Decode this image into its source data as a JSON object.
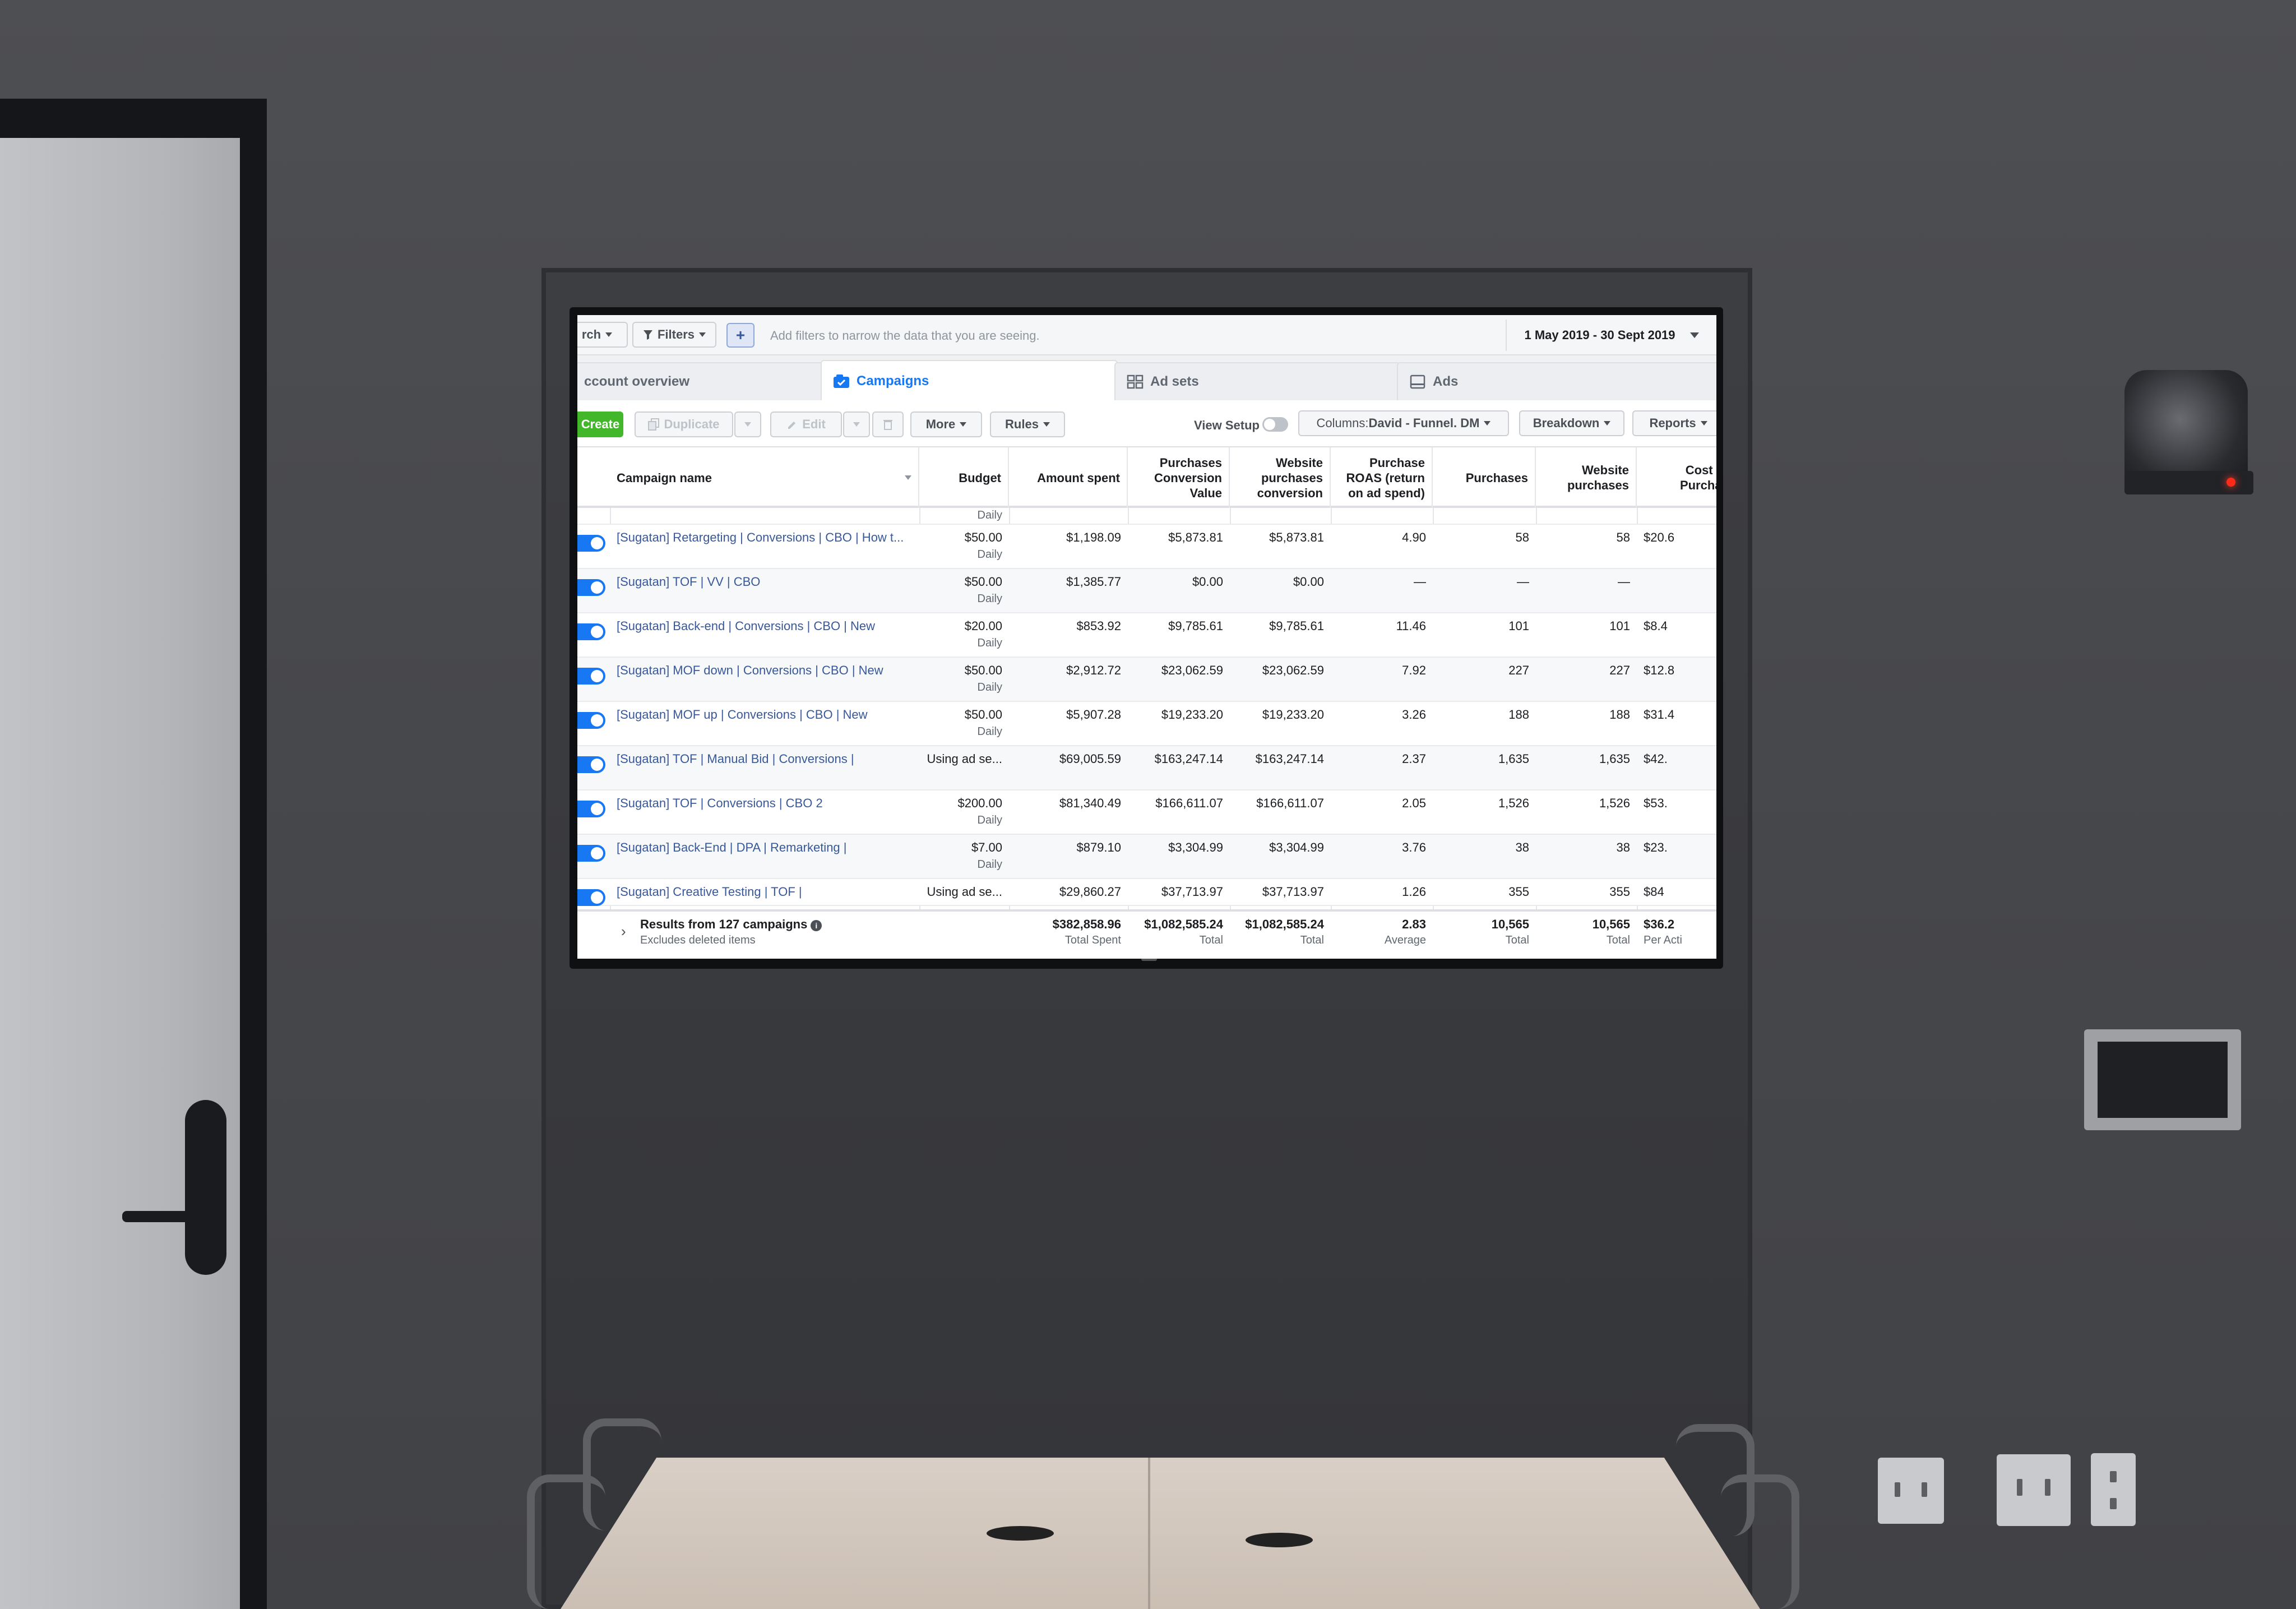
{
  "toolbar": {
    "search_label": "rch",
    "filters_label": "Filters",
    "add_symbol": "+",
    "filter_placeholder": "Add filters to narrow the data that you are seeing.",
    "date_range": "1 May 2019 - 30 Sept 2019"
  },
  "tabs": [
    {
      "label": "ccount overview"
    },
    {
      "label": "Campaigns"
    },
    {
      "label": "Ad sets"
    },
    {
      "label": "Ads"
    }
  ],
  "actions": {
    "create": "Create",
    "duplicate": "Duplicate",
    "edit": "Edit",
    "more": "More",
    "rules": "Rules",
    "view_setup": "View Setup",
    "columns_prefix": "Columns: ",
    "columns_value": "David - Funnel. DM",
    "breakdown": "Breakdown",
    "reports": "Reports"
  },
  "columns": [
    "Campaign name",
    "Budget",
    "Amount spent",
    "Purchases Conversion Value",
    "Website purchases conversion",
    "Purchase ROAS (return on ad spend)",
    "Purchases",
    "Website purchases",
    "Cost per Purchase"
  ],
  "partial_row_budget_sub": "Daily",
  "rows": [
    {
      "name": "[Sugatan] Retargeting | Conversions | CBO | How t...",
      "budget": "$50.00",
      "budget_sub": "Daily",
      "spent": "$1,198.09",
      "conv_value": "$5,873.81",
      "web_conv": "$5,873.81",
      "roas": "4.90",
      "purchases": "58",
      "web_purchases": "58",
      "cost": "$20.6"
    },
    {
      "name": "[Sugatan] TOF | VV | CBO",
      "budget": "$50.00",
      "budget_sub": "Daily",
      "spent": "$1,385.77",
      "conv_value": "$0.00",
      "web_conv": "$0.00",
      "roas": "—",
      "purchases": "—",
      "web_purchases": "—",
      "cost": ""
    },
    {
      "name": "[Sugatan] Back-end | Conversions | CBO | New",
      "budget": "$20.00",
      "budget_sub": "Daily",
      "spent": "$853.92",
      "conv_value": "$9,785.61",
      "web_conv": "$9,785.61",
      "roas": "11.46",
      "purchases": "101",
      "web_purchases": "101",
      "cost": "$8.4"
    },
    {
      "name": "[Sugatan] MOF down | Conversions | CBO | New",
      "budget": "$50.00",
      "budget_sub": "Daily",
      "spent": "$2,912.72",
      "conv_value": "$23,062.59",
      "web_conv": "$23,062.59",
      "roas": "7.92",
      "purchases": "227",
      "web_purchases": "227",
      "cost": "$12.8"
    },
    {
      "name": "[Sugatan] MOF up | Conversions | CBO | New",
      "budget": "$50.00",
      "budget_sub": "Daily",
      "spent": "$5,907.28",
      "conv_value": "$19,233.20",
      "web_conv": "$19,233.20",
      "roas": "3.26",
      "purchases": "188",
      "web_purchases": "188",
      "cost": "$31.4"
    },
    {
      "name": "[Sugatan] TOF | Manual Bid | Conversions |",
      "budget": "Using ad se...",
      "budget_sub": "",
      "spent": "$69,005.59",
      "conv_value": "$163,247.14",
      "web_conv": "$163,247.14",
      "roas": "2.37",
      "purchases": "1,635",
      "web_purchases": "1,635",
      "cost": "$42."
    },
    {
      "name": "[Sugatan] TOF | Conversions | CBO 2",
      "budget": "$200.00",
      "budget_sub": "Daily",
      "spent": "$81,340.49",
      "conv_value": "$166,611.07",
      "web_conv": "$166,611.07",
      "roas": "2.05",
      "purchases": "1,526",
      "web_purchases": "1,526",
      "cost": "$53."
    },
    {
      "name": "[Sugatan] Back-End | DPA | Remarketing |",
      "budget": "$7.00",
      "budget_sub": "Daily",
      "spent": "$879.10",
      "conv_value": "$3,304.99",
      "web_conv": "$3,304.99",
      "roas": "3.76",
      "purchases": "38",
      "web_purchases": "38",
      "cost": "$23."
    },
    {
      "name": "[Sugatan] Creative Testing | TOF |",
      "budget": "Using ad se...",
      "budget_sub": "",
      "spent": "$29,860.27",
      "conv_value": "$37,713.97",
      "web_conv": "$37,713.97",
      "roas": "1.26",
      "purchases": "355",
      "web_purchases": "355",
      "cost": "$84"
    }
  ],
  "totals": {
    "label": "Results from 127 campaigns",
    "info_icon": "i",
    "sub": "Excludes deleted items",
    "spent": "$382,858.96",
    "spent_sub": "Total Spent",
    "conv_value": "$1,082,585.24",
    "conv_value_sub": "Total",
    "web_conv": "$1,082,585.24",
    "web_conv_sub": "Total",
    "roas": "2.83",
    "roas_sub": "Average",
    "purchases": "10,565",
    "purchases_sub": "Total",
    "web_purchases": "10,565",
    "web_purchases_sub": "Total",
    "cost": "$36.2",
    "cost_sub": "Per Acti"
  },
  "colors": {
    "accent": "#1877f2",
    "create": "#42b72a",
    "link": "#385898"
  },
  "icons": [
    "filter-icon",
    "campaigns-icon",
    "adsets-icon",
    "ads-icon",
    "edit-icon",
    "duplicate-icon",
    "info-icon",
    "chevron-right-icon",
    "camera-led"
  ]
}
